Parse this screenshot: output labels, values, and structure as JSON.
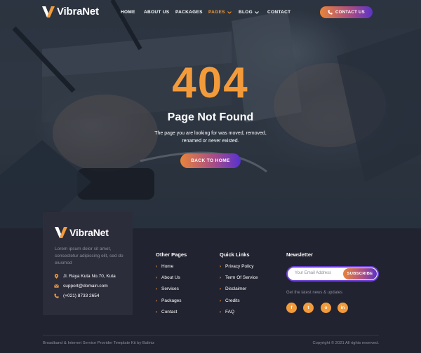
{
  "header": {
    "logo_text": "VibraNet",
    "nav": [
      {
        "label": "HOME"
      },
      {
        "label": "ABOUT US"
      },
      {
        "label": "PACKAGES"
      },
      {
        "label": "PAGES"
      },
      {
        "label": "BLOG"
      },
      {
        "label": "CONTACT"
      }
    ],
    "contact_button": "CONTACT US"
  },
  "hero": {
    "code": "404",
    "title": "Page Not Found",
    "description": "The page you are looking for was moved, removed, renamed or never existed.",
    "button": "BACK TO HOME"
  },
  "footer": {
    "logo_text": "VibraNet",
    "about": "Lorem ipsum dolor sit amet, consectetur adipiscing elit, sed do eiusmod",
    "address": "Jl. Raya Kuta No.70, Kuta",
    "email": "support@domain.com",
    "phone": "(+021) 8733 2654",
    "other_pages": {
      "title": "Other Pages",
      "links": [
        "Home",
        "About Us",
        "Services",
        "Packages",
        "Contact"
      ]
    },
    "quick_links": {
      "title": "Quick Links",
      "links": [
        "Privacy Policy",
        "Term Of Service",
        "Disclaimer",
        "Credits",
        "FAQ"
      ]
    },
    "newsletter": {
      "title": "Newsletter",
      "placeholder": "Your Email Address",
      "button": "SUBSCRIBE",
      "note": "Get the latest news & updates"
    },
    "social": [
      "f",
      "t",
      "o",
      "in"
    ],
    "credit": "Broadband & Internet Service Provider Template Kit by Baliniz",
    "copyright": "Copyright © 2021 All rights reserved."
  },
  "colors": {
    "accent": "#f39b3a",
    "gradient_start": "#e8843b",
    "gradient_end": "#5b33c9",
    "footer_bg": "#222330"
  }
}
